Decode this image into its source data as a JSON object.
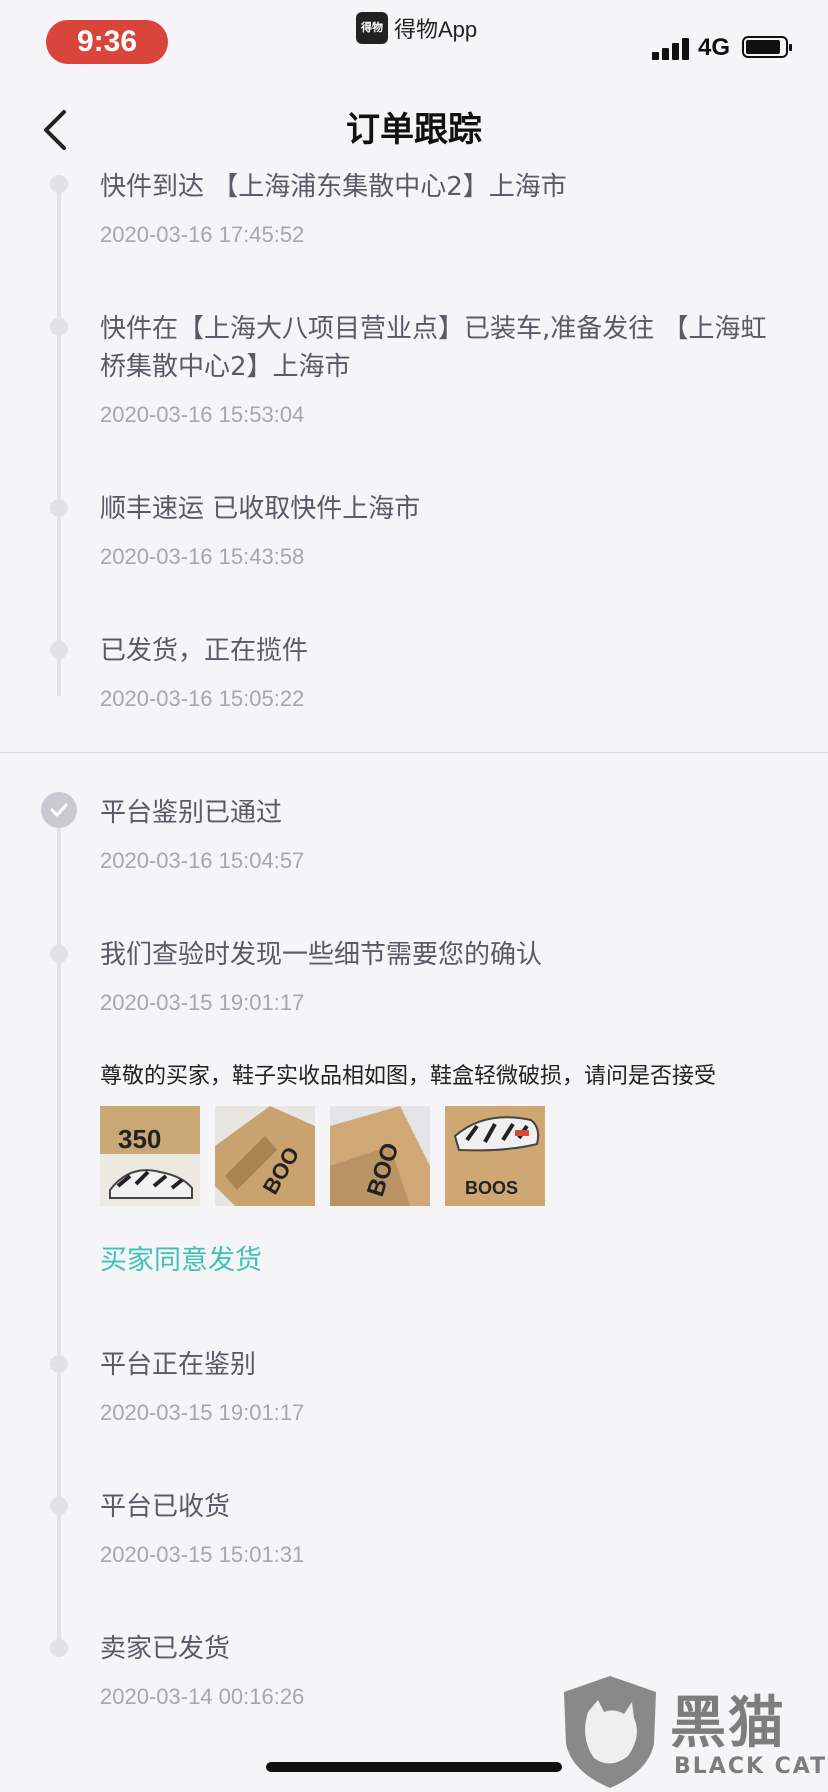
{
  "status_bar": {
    "time": "9:36",
    "app_name": "得物App",
    "app_logo": "得物",
    "network": "4G",
    "icons": [
      "signal-icon",
      "battery-icon"
    ]
  },
  "nav": {
    "title": "订单跟踪",
    "back_icon": "chevron-left-icon"
  },
  "events": [
    {
      "title": "快件到达 【上海浦东集散中心2】上海市",
      "time": "2020-03-16 17:45:52"
    },
    {
      "title": "快件在【上海大八项目营业点】已装车,准备发往 【上海虹桥集散中心2】上海市",
      "time": "2020-03-16 15:53:04"
    },
    {
      "title": "顺丰速运 已收取快件上海市",
      "time": "2020-03-16 15:43:58"
    },
    {
      "title": "已发货，正在揽件",
      "time": "2020-03-16 15:05:22"
    },
    {
      "title": "平台鉴别已通过",
      "time": "2020-03-16 15:04:57"
    },
    {
      "title": "我们查验时发现一些细节需要您的确认",
      "time": "2020-03-15 19:01:17"
    },
    {
      "title": "平台正在鉴别",
      "time": "2020-03-15 19:01:17"
    },
    {
      "title": "平台已收货",
      "time": "2020-03-15 15:01:31"
    },
    {
      "title": "卖家已发货",
      "time": "2020-03-14 00:16:26"
    }
  ],
  "confirmation": {
    "message": "尊敬的买家，鞋子实收品相如图，鞋盒轻微破损，请问是否接受",
    "photos": [
      "shoe-photo",
      "box-corner-photo",
      "box-side-photo",
      "shoe-box-photo"
    ],
    "agree_label": "买家同意发货"
  },
  "watermark": {
    "main": "黑猫",
    "sub": "BLACK CAT"
  },
  "colors": {
    "time_pill": "#d9453a",
    "link": "#3fc0b9",
    "timeline": "#e2e2e6"
  }
}
